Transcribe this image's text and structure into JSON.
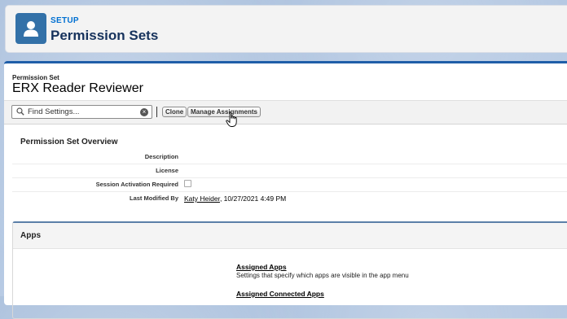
{
  "header": {
    "breadcrumb": "SETUP",
    "title": "Permission Sets",
    "logo_icon": "user-icon",
    "accent_color": "#3371a8"
  },
  "record": {
    "type_label": "Permission Set",
    "name": "ERX Reader Reviewer"
  },
  "toolbar": {
    "search_placeholder": "Find Settings...",
    "clone_label": "Clone",
    "manage_label": "Manage Assignments"
  },
  "overview": {
    "title": "Permission Set Overview",
    "rows": [
      {
        "label": "Description",
        "value": ""
      },
      {
        "label": "License",
        "value": ""
      },
      {
        "label": "Session Activation Required",
        "checked": false
      },
      {
        "label": "Last Modified By",
        "user": "Katy Heider",
        "date": ", 10/27/2021 4:49 PM"
      }
    ]
  },
  "apps": {
    "title": "Apps",
    "items": [
      {
        "label": "Assigned Apps",
        "description": "Settings that specify which apps are visible in the app menu"
      },
      {
        "label": "Assigned Connected Apps",
        "description": ""
      }
    ]
  }
}
